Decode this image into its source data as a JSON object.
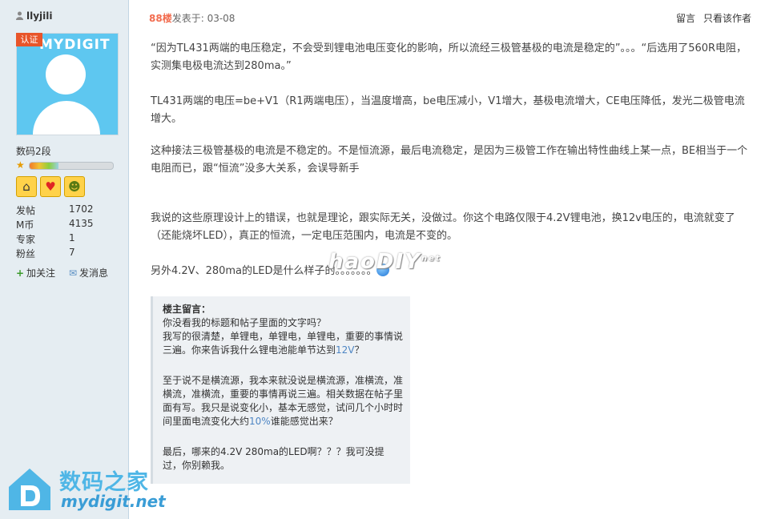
{
  "user": {
    "name": "llyjili",
    "cert_badge": "认证",
    "avatar_brand": "MYDIGIT",
    "rank": "数码2段",
    "level_progress": 0.35,
    "stats": [
      {
        "label": "发帖",
        "value": "1702"
      },
      {
        "label": "M币",
        "value": "4135"
      },
      {
        "label": "专家",
        "value": "1"
      },
      {
        "label": "粉丝",
        "value": "7"
      }
    ],
    "actions": {
      "follow": "加关注",
      "message": "发消息"
    }
  },
  "post": {
    "floor": "88楼",
    "posted_prefix": "发表于: ",
    "date": "03-08",
    "tools": {
      "reply": "留言",
      "only_author": "只看该作者"
    },
    "paragraphs": [
      "“因为TL431两端的电压稳定，不会受到锂电池电压变化的影响，所以流经三极管基极的电流是稳定的”。。。“后选用了560R电阻，实测集电极电流达到280ma。”",
      "TL431两端的电压=be+V1（R1两端电压），当温度增高，be电压减小，V1增大，基极电流增大，CE电压降低，发光二极管电流增大。",
      "这种接法三极管基极的电流是不稳定的。不是恒流源，最后电流稳定，是因为三极管工作在输出特性曲线上某一点，BE相当于一个电阻而已，跟“恒流”没多大关系，会误导新手",
      "我说的这些原理设计上的错误，也就是理论，跟实际无关，没做过。你这个电路仅限于4.2V锂电池，换12v电压的，电流就变了（还能烧坏LED），真正的恒流，一定电压范围内，电流是不变的。",
      "另外4.2V、280ma的LED是什么样子的。。。。。。。"
    ],
    "watermark": "haoDIY",
    "watermark_sup": "net"
  },
  "comment": {
    "title": "楼主留言：",
    "lines_1": [
      "你没看我的标题和帖子里面的文字吗？",
      "我写的很清楚，单锂电，单锂电，单锂电，重要的事情说三遍。你来告诉我什么锂电池能单节达到",
      "12V",
      "？"
    ],
    "para2": "至于说不是横流源，我本来就没说是横流源，准横流，准横流，准横流，重要的事情再说三遍。相关数据在帖子里面有写。我只是说变化小，基本无感觉，试问几个小时时间里面电流变化大约",
    "para2_hl": "10%",
    "para2_end": "谁能感觉出来？",
    "para3": "最后，哪来的4.2V 280ma的LED啊？？？我可没提过，你别赖我。"
  },
  "logo": {
    "cn": "数码之家",
    "en": "mydigit.net"
  }
}
